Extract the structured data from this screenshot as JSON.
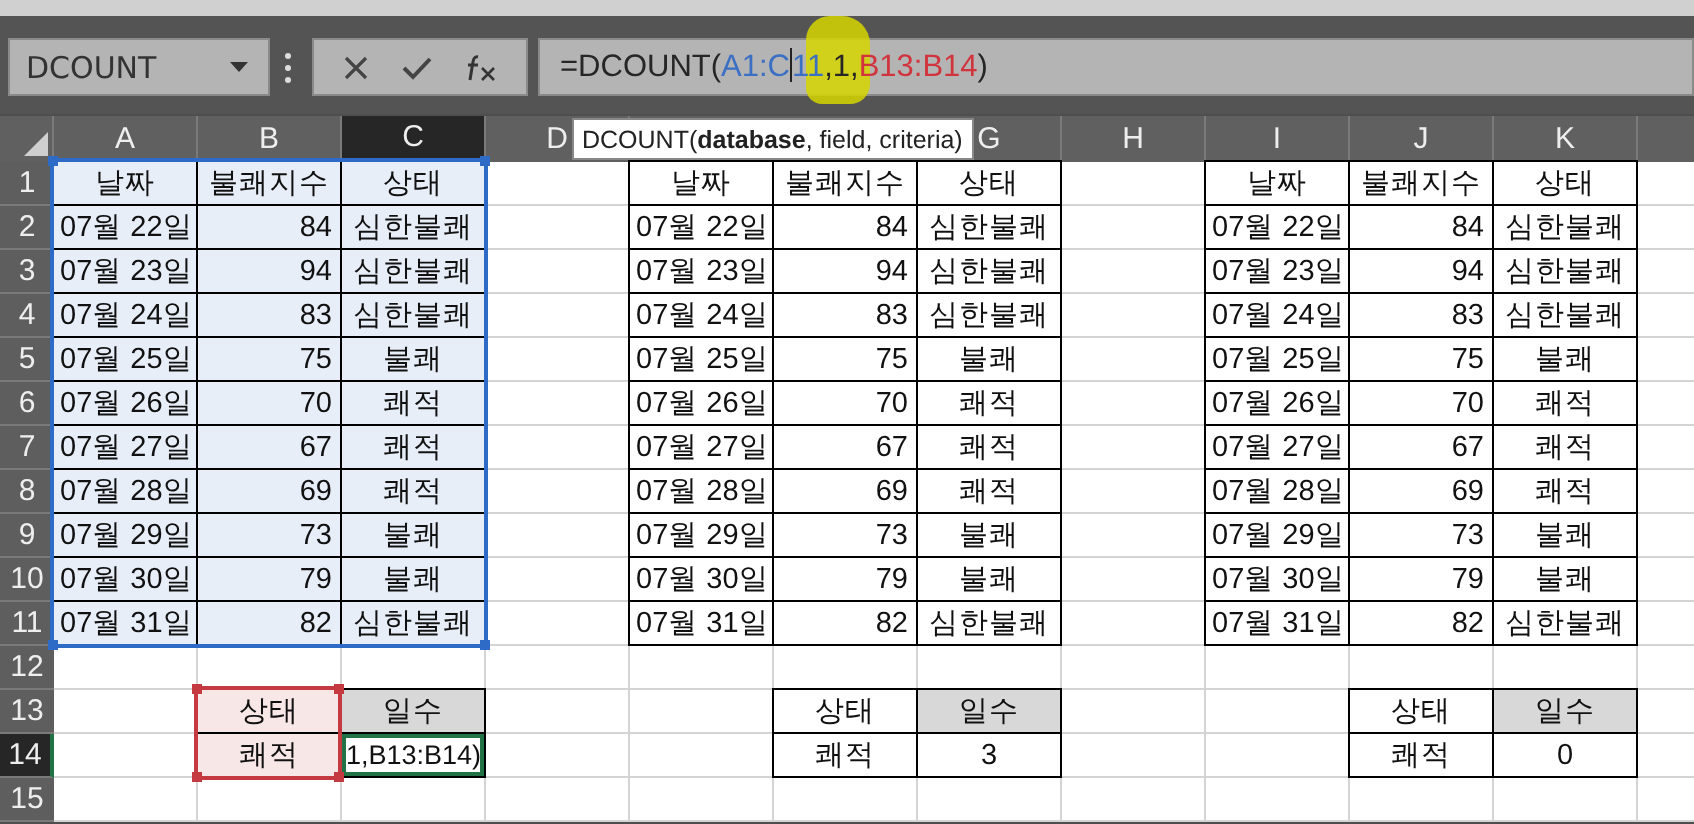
{
  "name_box": {
    "value": "DCOUNT"
  },
  "formula_bar": {
    "parts": [
      {
        "kind": "text",
        "text": "=DCOUNT(",
        "color": "#262626"
      },
      {
        "kind": "text",
        "text": "A1:C",
        "color": "#3a6fc4"
      },
      {
        "kind": "caret"
      },
      {
        "kind": "text",
        "text": "11",
        "color": "#3a6fc4"
      },
      {
        "kind": "text",
        "text": ",1,",
        "color": "#262626"
      },
      {
        "kind": "text",
        "text": "B13:B14",
        "color": "#d1343c"
      },
      {
        "kind": "text",
        "text": ")",
        "color": "#262626"
      }
    ]
  },
  "tooltip": "DCOUNT(**database**, field, criteria)",
  "column_headers": [
    {
      "label": "A",
      "selected": false
    },
    {
      "label": "B",
      "selected": false
    },
    {
      "label": "C",
      "selected": true
    },
    {
      "label": "D",
      "selected": false
    },
    {
      "label": "G",
      "selected": false
    },
    {
      "label": "H",
      "selected": false
    },
    {
      "label": "I",
      "selected": false
    },
    {
      "label": "J",
      "selected": false
    },
    {
      "label": "K",
      "selected": false
    }
  ],
  "row_headers": [
    {
      "label": "1",
      "selected": false
    },
    {
      "label": "2",
      "selected": false
    },
    {
      "label": "3",
      "selected": false
    },
    {
      "label": "4",
      "selected": false
    },
    {
      "label": "5",
      "selected": false
    },
    {
      "label": "6",
      "selected": false
    },
    {
      "label": "7",
      "selected": false
    },
    {
      "label": "8",
      "selected": false
    },
    {
      "label": "9",
      "selected": false
    },
    {
      "label": "10",
      "selected": false
    },
    {
      "label": "11",
      "selected": false
    },
    {
      "label": "12",
      "selected": false
    },
    {
      "label": "13",
      "selected": false
    },
    {
      "label": "14",
      "selected": true
    },
    {
      "label": "15",
      "selected": false
    }
  ],
  "data_tables": [
    {
      "selected": true,
      "header": [
        "날짜",
        "불쾌지수",
        "상태"
      ],
      "rows": [
        [
          "07월 22일",
          "84",
          "심한불쾌"
        ],
        [
          "07월 23일",
          "94",
          "심한불쾌"
        ],
        [
          "07월 24일",
          "83",
          "심한불쾌"
        ],
        [
          "07월 25일",
          "75",
          "불쾌"
        ],
        [
          "07월 26일",
          "70",
          "쾌적"
        ],
        [
          "07월 27일",
          "67",
          "쾌적"
        ],
        [
          "07월 28일",
          "69",
          "쾌적"
        ],
        [
          "07월 29일",
          "73",
          "불쾌"
        ],
        [
          "07월 30일",
          "79",
          "불쾌"
        ],
        [
          "07월 31일",
          "82",
          "심한불쾌"
        ]
      ]
    },
    {
      "selected": false,
      "header": [
        "날짜",
        "불쾌지수",
        "상태"
      ],
      "rows": [
        [
          "07월 22일",
          "84",
          "심한불쾌"
        ],
        [
          "07월 23일",
          "94",
          "심한불쾌"
        ],
        [
          "07월 24일",
          "83",
          "심한불쾌"
        ],
        [
          "07월 25일",
          "75",
          "불쾌"
        ],
        [
          "07월 26일",
          "70",
          "쾌적"
        ],
        [
          "07월 27일",
          "67",
          "쾌적"
        ],
        [
          "07월 28일",
          "69",
          "쾌적"
        ],
        [
          "07월 29일",
          "73",
          "불쾌"
        ],
        [
          "07월 30일",
          "79",
          "불쾌"
        ],
        [
          "07월 31일",
          "82",
          "심한불쾌"
        ]
      ]
    },
    {
      "selected": false,
      "header": [
        "날짜",
        "불쾌지수",
        "상태"
      ],
      "rows": [
        [
          "07월 22일",
          "84",
          "심한불쾌"
        ],
        [
          "07월 23일",
          "94",
          "심한불쾌"
        ],
        [
          "07월 24일",
          "83",
          "심한불쾌"
        ],
        [
          "07월 25일",
          "75",
          "불쾌"
        ],
        [
          "07월 26일",
          "70",
          "쾌적"
        ],
        [
          "07월 27일",
          "67",
          "쾌적"
        ],
        [
          "07월 28일",
          "69",
          "쾌적"
        ],
        [
          "07월 29일",
          "73",
          "불쾌"
        ],
        [
          "07월 30일",
          "79",
          "불쾌"
        ],
        [
          "07월 31일",
          "82",
          "심한불쾌"
        ]
      ]
    }
  ],
  "criteria_tables": [
    {
      "editing": true,
      "header": [
        "상태",
        "일수"
      ],
      "criteria": "쾌적",
      "result": "1,B13:B14)"
    },
    {
      "editing": false,
      "header": [
        "상태",
        "일수"
      ],
      "criteria": "쾌적",
      "result": "3"
    },
    {
      "editing": false,
      "header": [
        "상태",
        "일수"
      ],
      "criteria": "쾌적",
      "result": "0"
    }
  ]
}
